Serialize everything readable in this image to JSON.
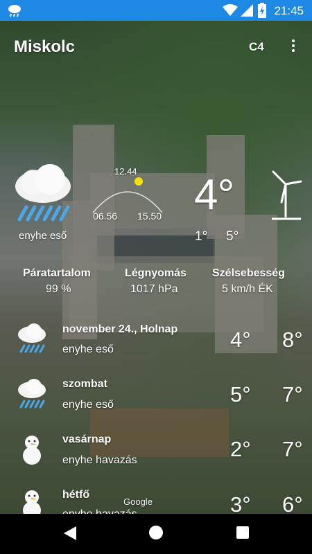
{
  "status": {
    "time": "21:45"
  },
  "app": {
    "city": "Miskolc",
    "badge": "C4"
  },
  "current": {
    "condition": "enyhe eső",
    "temp": "4°",
    "min": "1°",
    "max": "5°",
    "sun": {
      "noon": "12.44",
      "rise": "06.56",
      "set": "15.50"
    },
    "humidity": {
      "label": "Páratartalom",
      "value": "99 %"
    },
    "pressure": {
      "label": "Légnyomás",
      "value": "1017 hPa"
    },
    "wind": {
      "label": "Szélsebesség",
      "value": "5 km/h ÉK"
    }
  },
  "forecast": [
    {
      "day": "november 24., Holnap",
      "condition": "enyhe eső",
      "min": "4°",
      "max": "8°",
      "icon": "rain-cloud-icon"
    },
    {
      "day": "szombat",
      "condition": "enyhe eső",
      "min": "5°",
      "max": "7°",
      "icon": "rain-cloud-icon"
    },
    {
      "day": "vasárnap",
      "condition": "enyhe havazás",
      "min": "2°",
      "max": "7°",
      "icon": "snowman-icon"
    },
    {
      "day": "hétfő",
      "condition": "enyhe havazás",
      "min": "3°",
      "max": "6°",
      "icon": "snowman-icon"
    }
  ],
  "map_watermark": "Google"
}
